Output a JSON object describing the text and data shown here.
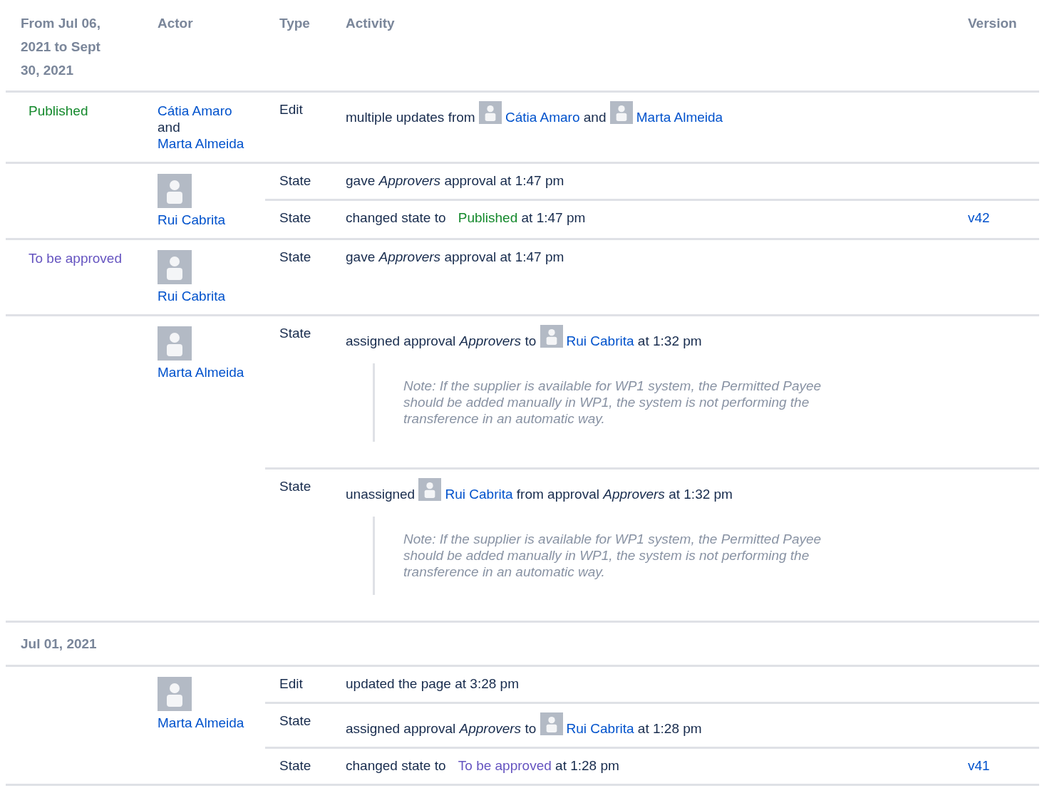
{
  "header": {
    "columns": [
      "From Jul 06, 2021 to Sept 30, 2021",
      "Actor",
      "Type",
      "Activity",
      "Version"
    ]
  },
  "rows": [
    {
      "kind": "group",
      "status": {
        "text": "Published",
        "color": "#14892c"
      },
      "actor": [
        {
          "kind": "link",
          "text": "Cátia Amaro"
        },
        {
          "kind": "text",
          "text": "and"
        },
        {
          "kind": "link",
          "text": "Marta Almeida"
        }
      ],
      "entries": [
        {
          "type": "Edit",
          "activity": [
            {
              "kind": "text",
              "text": "multiple updates from"
            },
            {
              "kind": "user",
              "text": "Cátia Amaro"
            },
            {
              "kind": "text",
              "text": "and"
            },
            {
              "kind": "user",
              "text": "Marta Almeida"
            }
          ]
        }
      ]
    },
    {
      "kind": "group",
      "actor": [
        {
          "kind": "user",
          "text": "Rui Cabrita"
        }
      ],
      "entries": [
        {
          "type": "State",
          "activity": [
            {
              "kind": "text",
              "text": "gave"
            },
            {
              "kind": "em",
              "text": "Approvers"
            },
            {
              "kind": "text",
              "text": "approval at 1:47 pm"
            }
          ]
        },
        {
          "type": "State",
          "activity": [
            {
              "kind": "text",
              "text": "changed state to"
            },
            {
              "kind": "status",
              "text": "Published",
              "color": "#14892c"
            },
            {
              "kind": "text",
              "text": "at 1:47 pm"
            }
          ],
          "version": "v42"
        }
      ]
    },
    {
      "kind": "group",
      "status": {
        "text": "To be approved",
        "color": "#6554c0"
      },
      "actor": [
        {
          "kind": "user",
          "text": "Rui Cabrita"
        }
      ],
      "entries": [
        {
          "type": "State",
          "activity": [
            {
              "kind": "text",
              "text": "gave"
            },
            {
              "kind": "em",
              "text": "Approvers"
            },
            {
              "kind": "text",
              "text": "approval at 1:47 pm"
            }
          ]
        }
      ]
    },
    {
      "kind": "group",
      "actor": [
        {
          "kind": "user",
          "text": "Marta Almeida"
        }
      ],
      "entries": [
        {
          "type": "State",
          "activity": [
            {
              "kind": "text",
              "text": "assigned approval"
            },
            {
              "kind": "em",
              "text": "Approvers"
            },
            {
              "kind": "text",
              "text": "to"
            },
            {
              "kind": "user",
              "text": "Rui Cabrita"
            },
            {
              "kind": "text",
              "text": "at 1:32 pm"
            }
          ],
          "note": "Note: If the supplier is available for WP1 system, the Permitted Payee should be added manually in WP1, the system is not performing the transference in an automatic way."
        },
        {
          "type": "State",
          "activity": [
            {
              "kind": "text",
              "text": "unassigned"
            },
            {
              "kind": "user",
              "text": "Rui Cabrita"
            },
            {
              "kind": "text",
              "text": "from approval"
            },
            {
              "kind": "em",
              "text": "Approvers"
            },
            {
              "kind": "text",
              "text": "at 1:32 pm"
            }
          ],
          "note": "Note: If the supplier is available for WP1 system, the Permitted Payee should be added manually in WP1, the system is not performing the transference in an automatic way."
        }
      ]
    },
    {
      "kind": "date",
      "text": "Jul 01, 2021"
    },
    {
      "kind": "group",
      "actor": [
        {
          "kind": "user",
          "text": "Marta Almeida"
        }
      ],
      "entries": [
        {
          "type": "Edit",
          "activity": [
            {
              "kind": "text",
              "text": "updated the page at 3:28 pm"
            }
          ]
        },
        {
          "type": "State",
          "activity": [
            {
              "kind": "text",
              "text": "assigned approval"
            },
            {
              "kind": "em",
              "text": "Approvers"
            },
            {
              "kind": "text",
              "text": "to"
            },
            {
              "kind": "user",
              "text": "Rui Cabrita"
            },
            {
              "kind": "text",
              "text": "at 1:28 pm"
            }
          ]
        },
        {
          "type": "State",
          "activity": [
            {
              "kind": "text",
              "text": "changed state to"
            },
            {
              "kind": "status",
              "text": "To be approved",
              "color": "#6554c0"
            },
            {
              "kind": "text",
              "text": "at 1:28 pm"
            }
          ],
          "version": "v41"
        }
      ]
    }
  ]
}
